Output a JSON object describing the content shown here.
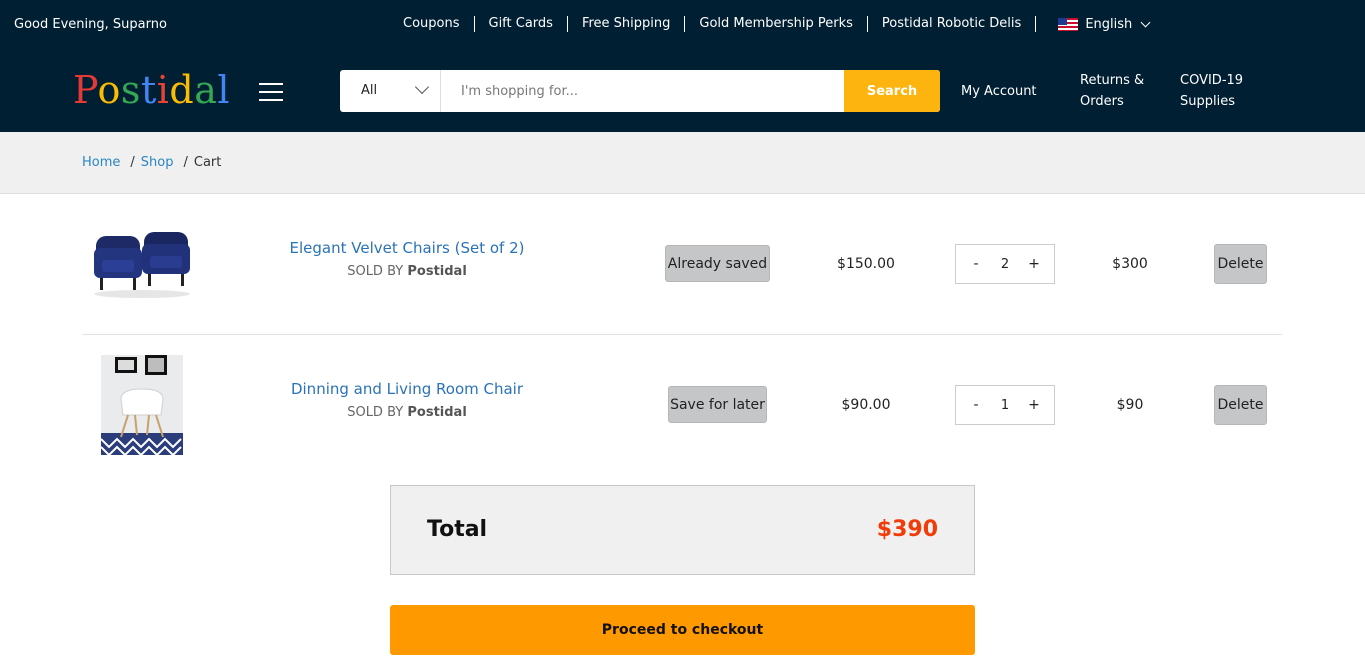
{
  "topbar": {
    "greeting": "Good Evening, Suparno",
    "links": [
      "Coupons",
      "Gift Cards",
      "Free Shipping",
      "Gold Membership Perks",
      "Postidal Robotic Delis"
    ],
    "language": "English"
  },
  "header": {
    "logo": "Postidal",
    "search": {
      "category": "All",
      "placeholder": "I'm shopping for...",
      "button": "Search"
    },
    "my_account": "My Account",
    "returns_line1": "Returns &",
    "returns_line2": "Orders",
    "covid_line1": "COVID-19",
    "covid_line2": "Supplies"
  },
  "breadcrumb": {
    "home": "Home",
    "shop": "Shop",
    "sep": "/",
    "current": "Cart"
  },
  "cart": {
    "sold_by_prefix": "SOLD BY",
    "items": [
      {
        "name": "Elegant Velvet Chairs (Set of 2)",
        "seller": "Postidal",
        "save_label": "Already saved",
        "price": "$150.00",
        "qty_minus": "-",
        "qty": "2",
        "qty_plus": "+",
        "subtotal": "$300",
        "delete_label": "Delete"
      },
      {
        "name": "Dinning and Living Room Chair",
        "seller": "Postidal",
        "save_label": "Save for later",
        "price": "$90.00",
        "qty_minus": "-",
        "qty": "1",
        "qty_plus": "+",
        "subtotal": "$90",
        "delete_label": "Delete"
      }
    ]
  },
  "summary": {
    "total_label": "Total",
    "total_value": "$390",
    "checkout_label": "Proceed to checkout"
  },
  "colors": {
    "nav_bg": "#011f33",
    "search_button": "#fdb40f",
    "checkout_button": "#ff9900",
    "total_price": "#f03c0a",
    "link": "#2a73b8"
  }
}
